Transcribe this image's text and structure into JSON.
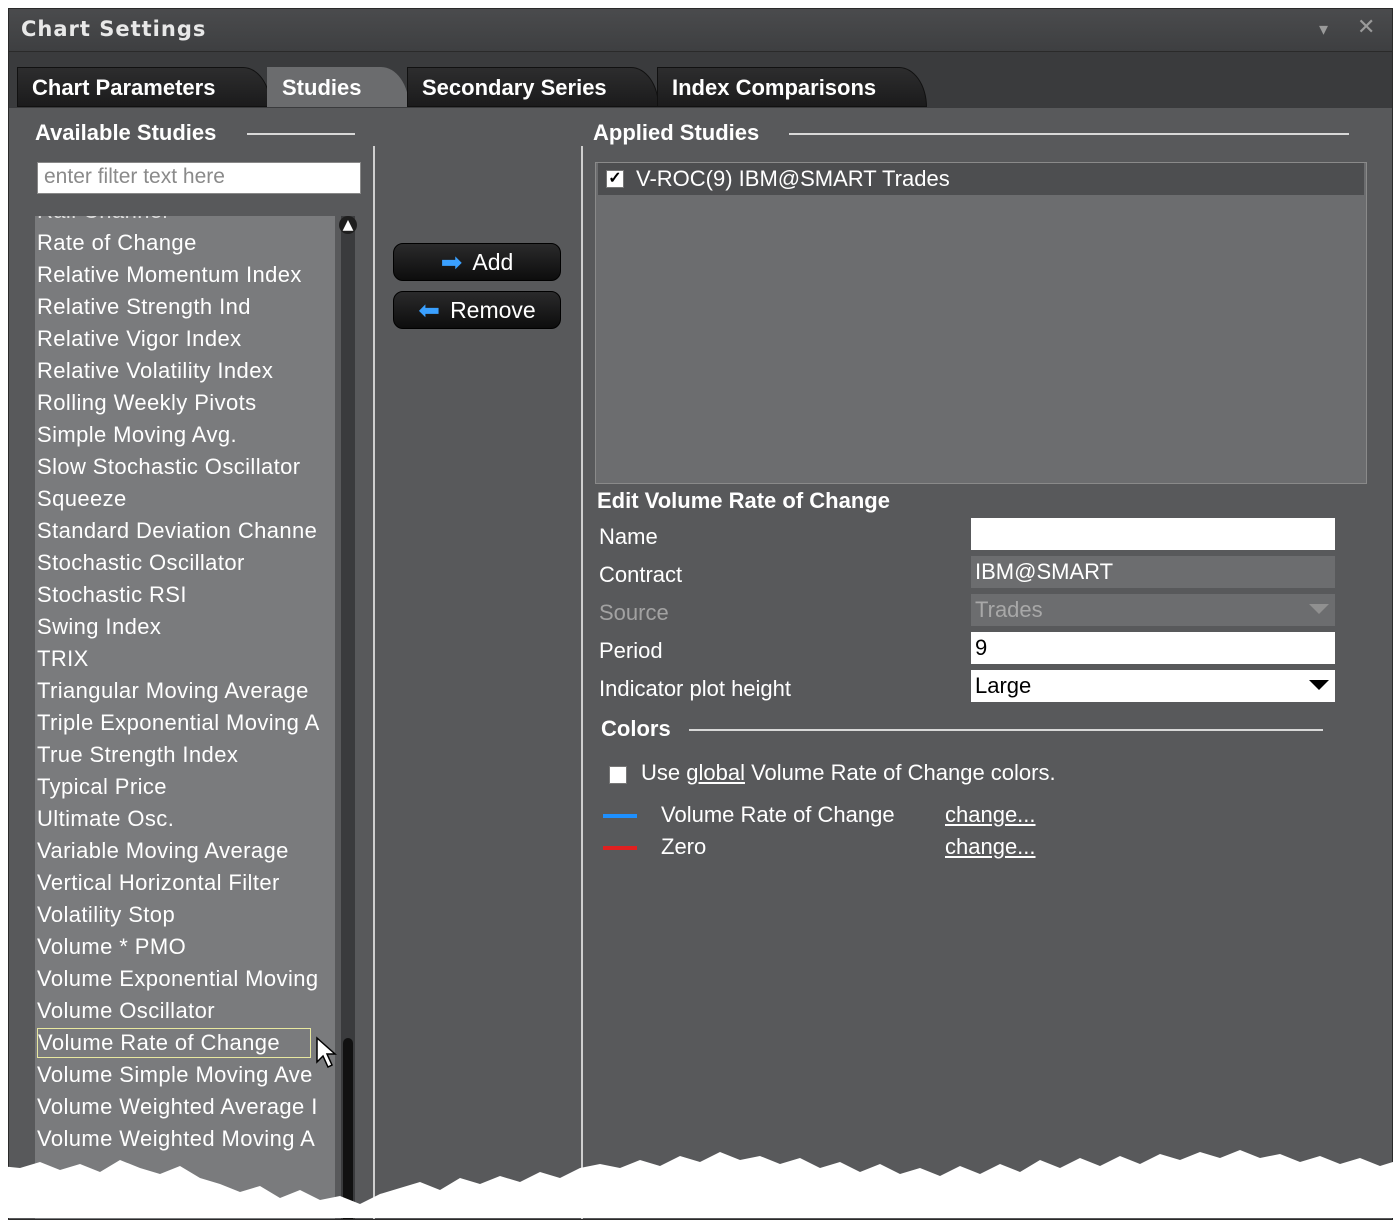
{
  "window": {
    "title": "Chart Settings"
  },
  "tabs": [
    "Chart Parameters",
    "Studies",
    "Secondary Series",
    "Index Comparisons"
  ],
  "available": {
    "title": "Available Studies",
    "filter_placeholder": "enter filter text here",
    "items": [
      "Rate of Change",
      "Relative Momentum Index",
      "Relative Strength Ind",
      "Relative Vigor Index",
      "Relative Volatility Index",
      "Rolling Weekly Pivots",
      "Simple Moving Avg.",
      "Slow Stochastic Oscillator",
      "Squeeze",
      "Standard Deviation Channe",
      "Stochastic Oscillator",
      "Stochastic RSI",
      "Swing Index",
      "TRIX",
      "Triangular Moving Average",
      "Triple Exponential Moving A",
      "True Strength Index",
      "Typical Price",
      "Ultimate Osc.",
      "Variable Moving Average",
      "Vertical Horizontal Filter",
      "Volatility Stop",
      "Volume * PMO",
      "Volume Exponential Moving",
      "Volume Oscillator",
      "Volume Rate of Change",
      "Volume Simple Moving Ave",
      "Volume Weighted Average I",
      "Volume Weighted Moving A"
    ],
    "selected": "Volume Rate of Change"
  },
  "buttons": {
    "add": "Add",
    "remove": "Remove"
  },
  "applied": {
    "title": "Applied Studies",
    "items": [
      "V-ROC(9) IBM@SMART Trades"
    ]
  },
  "edit": {
    "title": "Edit Volume Rate of Change",
    "name_label": "Name",
    "name_value": "",
    "contract_label": "Contract",
    "contract_value": "IBM@SMART",
    "source_label": "Source",
    "source_value": "Trades",
    "period_label": "Period",
    "period_value": "9",
    "height_label": "Indicator plot height",
    "height_value": "Large"
  },
  "colors": {
    "title": "Colors",
    "global_pre": "Use",
    "global_link": "global",
    "global_post": "Volume Rate of Change colors.",
    "rows": [
      {
        "name": "Volume Rate of Change",
        "color": "#1e90ff",
        "action": "change..."
      },
      {
        "name": "Zero",
        "color": "#e02020",
        "action": "change..."
      }
    ]
  }
}
